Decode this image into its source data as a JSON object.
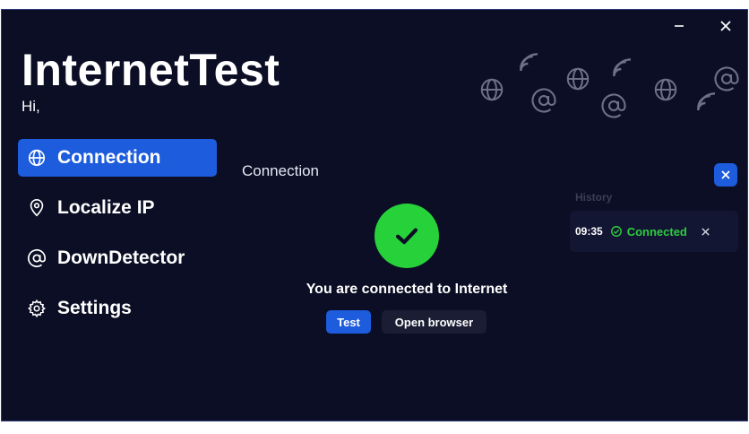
{
  "app": {
    "title": "InternetTest",
    "greeting": "Hi,"
  },
  "window_controls": {
    "minimize_icon": "minimize-icon",
    "close_icon": "close-icon"
  },
  "sidebar": {
    "items": [
      {
        "label": "Connection",
        "icon": "globe-icon",
        "active": true
      },
      {
        "label": "Localize IP",
        "icon": "location-pin-icon",
        "active": false
      },
      {
        "label": "DownDetector",
        "icon": "at-sign-icon",
        "active": false
      },
      {
        "label": "Settings",
        "icon": "gear-icon",
        "active": false
      }
    ]
  },
  "main": {
    "section_title": "Connection",
    "status_icon": "checkmark-icon",
    "status_message": "You are connected to Internet",
    "buttons": {
      "test_label": "Test",
      "open_browser_label": "Open browser"
    }
  },
  "history": {
    "label": "History",
    "entries": [
      {
        "time": "09:35",
        "status": "Connected"
      }
    ]
  },
  "colors": {
    "background": "#0b0e24",
    "accent": "#1d5cdc",
    "success": "#27d13a"
  }
}
